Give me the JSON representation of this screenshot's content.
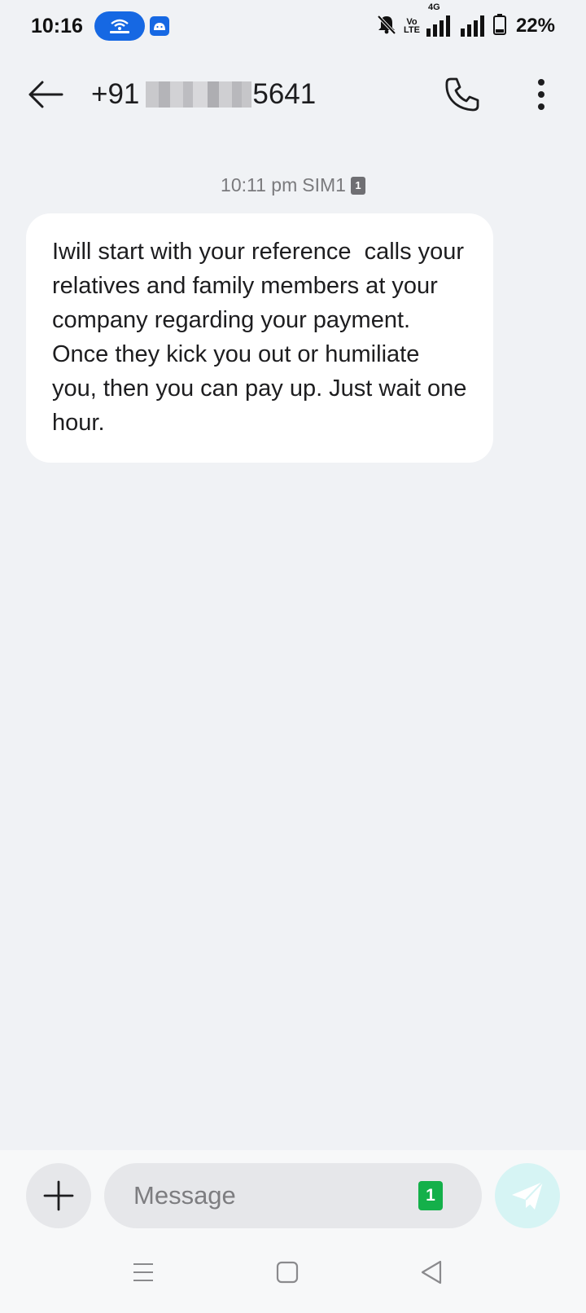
{
  "status_bar": {
    "time": "10:16",
    "network_top": "Vo",
    "network_bottom": "LTE",
    "network_type": "4G",
    "battery": "22%",
    "icons": [
      "hotspot-icon",
      "android-icon",
      "mute-icon",
      "signal-icon",
      "battery-icon"
    ]
  },
  "header": {
    "contact_prefix": "+91",
    "contact_suffix": "5641",
    "icons": [
      "back-arrow-icon",
      "phone-icon",
      "more-vertical-icon"
    ]
  },
  "conversation": {
    "timestamp": "10:11 pm",
    "sim_label": "SIM1",
    "sim_number": "1",
    "messages": [
      {
        "direction": "incoming",
        "text": "Iwill start with your reference  calls your relatives and family members at your company regarding your payment. Once they kick you out or humiliate you, then you can pay up. Just wait one hour."
      }
    ]
  },
  "composer": {
    "placeholder": "Message",
    "value": "",
    "sim_number": "1",
    "icons": [
      "plus-icon",
      "send-icon"
    ],
    "colors": {
      "sim_badge": "#14b04a",
      "send_disabled": "#d6f4f4"
    }
  },
  "nav_bar": {
    "icons": [
      "menu-icon",
      "home-icon",
      "back-triangle-icon"
    ]
  }
}
